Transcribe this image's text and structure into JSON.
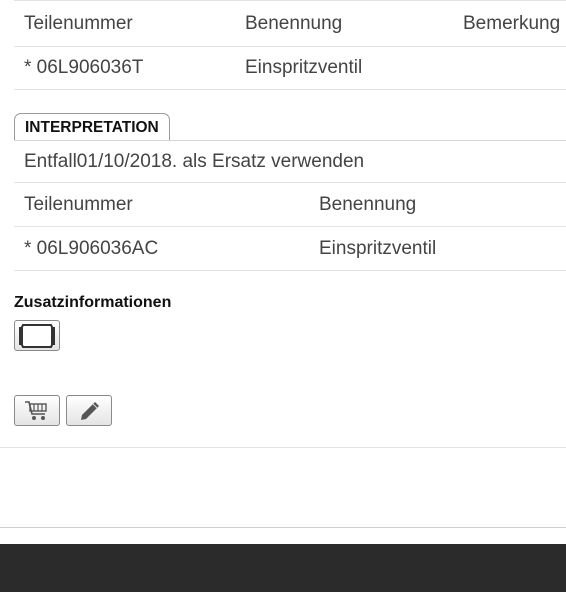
{
  "table_old": {
    "headers": [
      "Teilenummer",
      "Benennung",
      "Bemerkung"
    ],
    "rows": [
      {
        "part_number": "* 06L906036T",
        "designation": "Einspritzventil",
        "remark": ""
      }
    ]
  },
  "interpretation": {
    "tab_label": "INTERPRETATION",
    "note": "Entfall01/10/2018. als Ersatz verwenden"
  },
  "table_new": {
    "headers": [
      "Teilenummer",
      "Benennung"
    ],
    "rows": [
      {
        "part_number": "* 06L906036AC",
        "designation": "Einspritzventil"
      }
    ]
  },
  "additional_info": {
    "title": "Zusatzinformationen",
    "icon": "image-frame-icon"
  },
  "actions": [
    {
      "icon": "cart-icon"
    },
    {
      "icon": "pencil-icon"
    }
  ],
  "colors": {
    "footer": "#2b2b2b",
    "border": "#e3e3e3",
    "text": "#444444"
  }
}
